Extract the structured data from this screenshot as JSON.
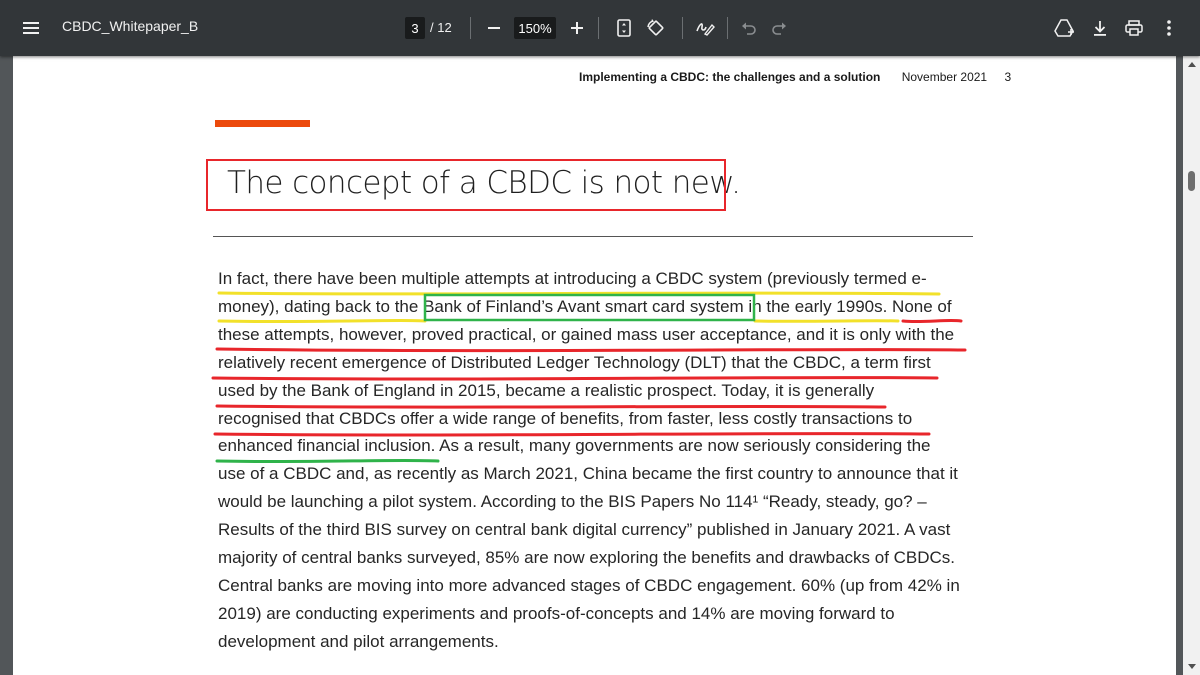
{
  "toolbar": {
    "doc_title": "CBDC_Whitepaper_B",
    "current_page": "3",
    "total_pages": "/ 12",
    "zoom": "150%",
    "zoom_out_label": "–",
    "zoom_in_label": "+",
    "bg_color": "#323639"
  },
  "page": {
    "running_header": {
      "title": "Implementing a CBDC: the challenges and a solution",
      "date": "November 2021",
      "page_no": "3"
    },
    "accent_color": "#ec4a0c",
    "heading": "The concept of a CBDC is not new.",
    "paragraph_lines": [
      "In fact, there have been multiple attempts at introducing a CBDC system (previously termed e-",
      "money), dating back to the Bank of Finland’s Avant smart card system in the early 1990s. None of",
      "these attempts, however, proved practical, or gained mass user acceptance, and it is only with the",
      "relatively recent emergence of Distributed Ledger Technology (DLT) that the CBDC, a term first",
      "used by the Bank of England in 2015, became a realistic prospect.  Today, it is generally",
      "recognised that CBDCs offer a wide range of benefits, from faster, less costly transactions to",
      "enhanced financial inclusion. As a result, many governments are now seriously considering the",
      "use of a CBDC and, as recently as March 2021, China became the first country to announce that it",
      "would be launching a pilot system. According to the BIS Papers No 114¹ “Ready, steady, go? –",
      "Results of the third BIS survey on central bank digital currency” published in January 2021. A vast",
      "majority of central banks surveyed, 85% are now exploring the benefits and drawbacks of CBDCs.",
      "Central banks are moving into more advanced stages of CBDC engagement. 60% (up from 42% in",
      "2019) are conducting experiments and proofs-of-concepts and 14% are moving forward to",
      "development and pilot arrangements."
    ],
    "annotation_colors": {
      "red": "#e8262b",
      "yellow": "#f2e12a",
      "green": "#2fb34a"
    }
  }
}
